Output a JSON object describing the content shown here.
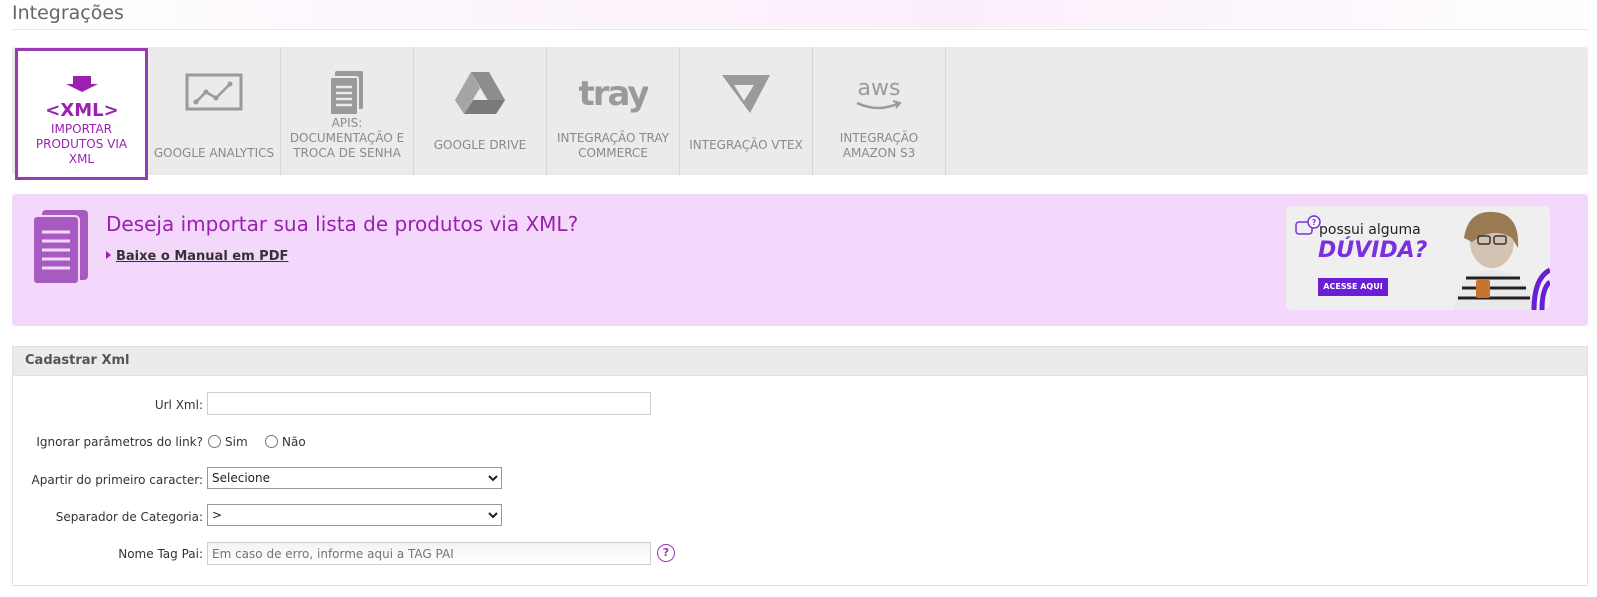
{
  "page": {
    "title": "Integrações"
  },
  "tabs": [
    {
      "icon": "xml-import-icon",
      "label": "IMPORTAR PRODUTOS VIA XML",
      "active": true
    },
    {
      "icon": "analytics-chart-icon",
      "label": "GOOGLE ANALYTICS",
      "active": false
    },
    {
      "icon": "document-icon",
      "label": "APIS: DOCUMENTAÇÃO E TROCA DE SENHA",
      "active": false
    },
    {
      "icon": "google-drive-icon",
      "label": "GOOGLE DRIVE",
      "active": false
    },
    {
      "icon": "tray-logo-icon",
      "label": "INTEGRAÇÃO TRAY COMMERCE",
      "active": false
    },
    {
      "icon": "vtex-logo-icon",
      "label": "INTEGRAÇÃO VTEX",
      "active": false
    },
    {
      "icon": "aws-logo-icon",
      "label": "INTEGRAÇÃO AMAZON S3",
      "active": false
    }
  ],
  "tab_icon_text": {
    "xml": "<XML>",
    "tray": "tray",
    "aws": "aws"
  },
  "banner": {
    "title": "Deseja importar sua lista de produtos via XML?",
    "link": "Baixe o Manual em PDF"
  },
  "help_ad": {
    "line1": "possui alguma",
    "line2": "DÚVIDA?",
    "cta": "ACESSE AQUI"
  },
  "form": {
    "header": "Cadastrar Xml",
    "url_label": "Url Xml:",
    "url_value": "",
    "ignore_label": "Ignorar parâmetros do link?",
    "ignore_yes": "Sim",
    "ignore_no": "Não",
    "from_char_label": "Apartir do primeiro caracter:",
    "from_char_value": "Selecione",
    "separator_label": "Separador de Categoria:",
    "separator_value": ">",
    "parent_tag_label": "Nome Tag Pai:",
    "parent_tag_placeholder": "Em caso de erro, informe aqui a TAG PAI",
    "help_symbol": "?"
  },
  "colors": {
    "accent": "#9b1fb0",
    "banner_bg": "#f3d8fb",
    "tab_bg": "#ebebeb"
  }
}
